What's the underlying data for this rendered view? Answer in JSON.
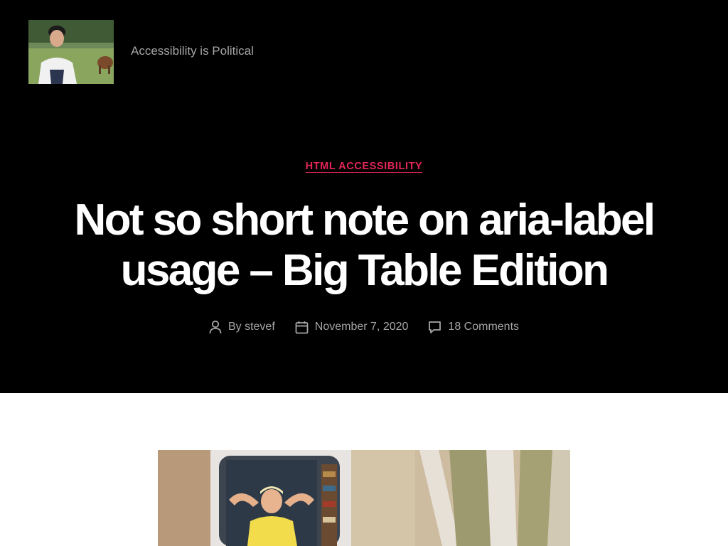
{
  "site": {
    "tagline": "Accessibility is Political",
    "logo_alt": "site-logo-photo"
  },
  "post": {
    "category": "HTML ACCESSIBILITY",
    "title": "Not so short note on aria-label usage – Big Table Edition",
    "author_label": "By stevef",
    "date": "November 7, 2020",
    "comments": "18 Comments"
  },
  "icons": {
    "author": "user-icon",
    "date": "calendar-icon",
    "comments": "comment-icon"
  },
  "colors": {
    "header_background": "#000000",
    "accent": "#e22658",
    "meta_text": "#a6a6a6",
    "title_text": "#ffffff"
  }
}
